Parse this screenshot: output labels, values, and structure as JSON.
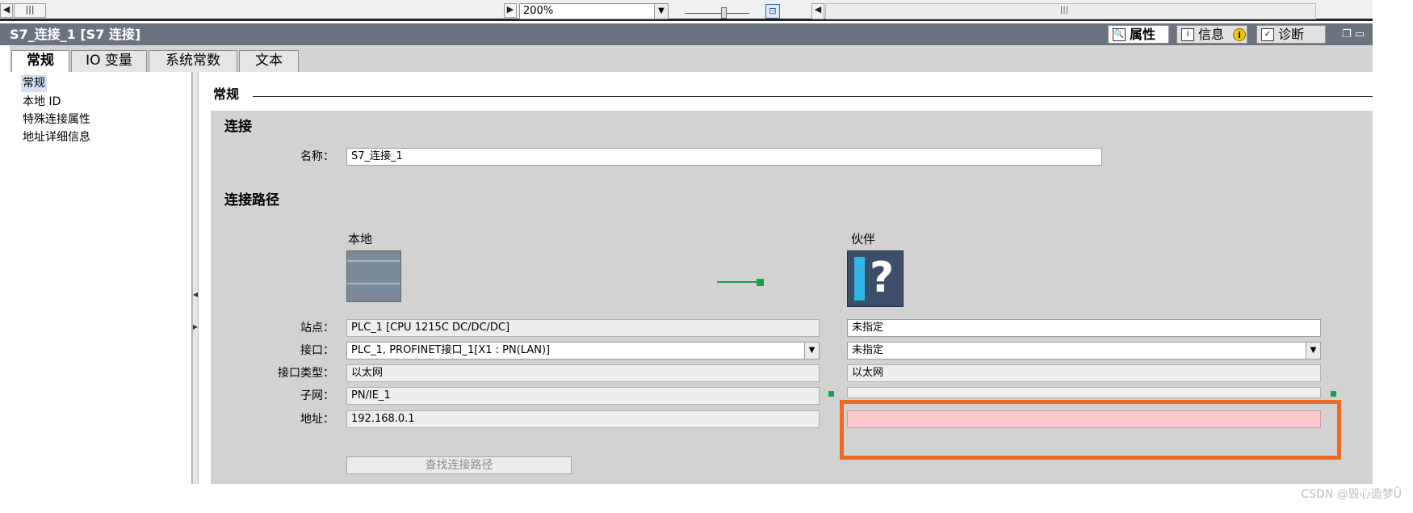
{
  "toolbar": {
    "zoom_value": "200%"
  },
  "window": {
    "title": "S7_连接_1 [S7 连接]",
    "right_tabs": [
      {
        "label": "属性",
        "icon": "properties-icon"
      },
      {
        "label": "信息",
        "icon": "info-icon"
      },
      {
        "label": "诊断",
        "icon": "diagnostics-icon"
      }
    ]
  },
  "tabs": [
    "常规",
    "IO 变量",
    "系统常数",
    "文本"
  ],
  "nav": [
    "常规",
    "本地 ID",
    "特殊连接属性",
    "地址详细信息"
  ],
  "section": {
    "title": "常规",
    "connection_title": "连接",
    "name_label": "名称：",
    "name_value": "S7_连接_1",
    "path_title": "连接路径",
    "local_label": "本地",
    "partner_label": "伙伴"
  },
  "rows": {
    "station": {
      "label": "站点：",
      "local": "PLC_1 [CPU 1215C DC/DC/DC]",
      "partner": "未指定"
    },
    "interface": {
      "label": "接口：",
      "local": "PLC_1, PROFINET接口_1[X1 : PN(LAN)]",
      "partner": "未指定"
    },
    "interface_type": {
      "label": "接口类型：",
      "local": "以太网",
      "partner": "以太网"
    },
    "subnet": {
      "label": "子网：",
      "local": "PN/IE_1",
      "partner": ""
    },
    "address": {
      "label": "地址：",
      "local": "192.168.0.1",
      "partner": ""
    }
  },
  "find_button": "查找连接路径",
  "watermark": "CSDN @毁心造梦Ü",
  "colors": {
    "accent_connection": "#14a14a",
    "highlight_box": "#f06a27",
    "error_field": "#fcc8cc"
  }
}
